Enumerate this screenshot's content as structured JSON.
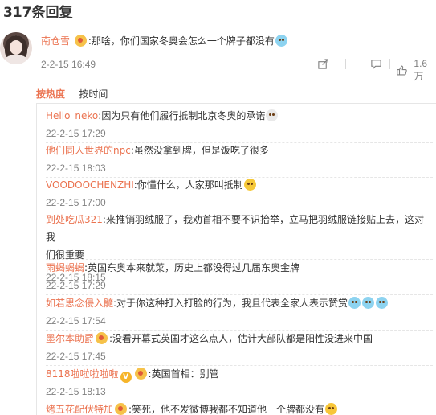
{
  "header": {
    "title": "317条回复"
  },
  "main_comment": {
    "username": "南仓雪",
    "text": ":那啥，你们国家冬奥会怎么一个牌子都没有",
    "time": "2-2-15 16:49",
    "like_count": "1.6万"
  },
  "sort_tabs": {
    "hot": "按热度",
    "time": "按时间"
  },
  "replies": [
    {
      "user": "Hello_neko",
      "text": ":因为只有他们履行抵制北京冬奥的承诺",
      "time": "22-2-15 17:29"
    },
    {
      "user": "他们同人世界的npc",
      "text": ":虽然没拿到牌，但是饭吃了很多",
      "time": "22-2-15 18:03"
    },
    {
      "user": "VOODOOCHENZHI",
      "text": ":你懂什么，人家那叫抵制",
      "time": "22-2-15 17:00"
    },
    {
      "user": "到处吃瓜321",
      "text": ":来推销羽绒服了，我劝首相不要不识抬举，立马把羽绒服链接贴上去，这对我",
      "text2": "们很重要",
      "time": "22-2-15 18:15"
    },
    {
      "user": "雨蝎蝎蝎",
      "text": ":英国东奥本来就菜，历史上都没得过几届东奥金牌",
      "time": "22-2-15 17:29"
    },
    {
      "user": "如若思念侵入髓",
      "text": ":对于你这种打入打脸的行为，我且代表全家人表示赞赏",
      "time": "22-2-15 17:54"
    },
    {
      "user": "墨尔本助爵",
      "text": ":没看开幕式英国才这么点人，估计大部队都是阳性没进来中国",
      "time": "22-2-15 17:45"
    },
    {
      "user": "8118啦啦啦啦啦",
      "text": ":英国首相：别管",
      "time": "22-2-15 18:13"
    },
    {
      "user": "烤五花配伏特加",
      "text": ":笑死，他不发微博我都不知道他一个牌都没有",
      "time": ""
    }
  ],
  "icons": [
    "share-icon",
    "comment-icon",
    "like-icon"
  ],
  "colors": {
    "username": "#eb7350",
    "meta": "#808080",
    "text": "#333333"
  }
}
